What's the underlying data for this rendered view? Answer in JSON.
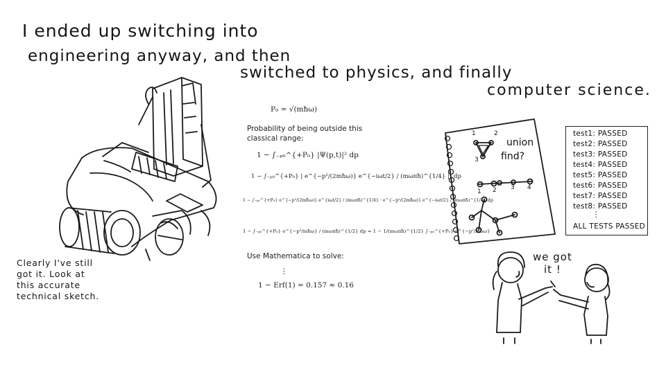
{
  "heading": {
    "line1": "I ended up switching into",
    "line2": "engineering anyway, and then",
    "line3": "switched to  physics, and finally",
    "line4": "computer science."
  },
  "caption": {
    "line1": "Clearly I've still",
    "line2": "got it. Look at",
    "line3": "this accurate",
    "line4": "technical sketch."
  },
  "math": {
    "p0": "P₀ = √(mħω)",
    "prob1": "Probability of being outside this",
    "prob2": "classical range:",
    "eq1": "1 − ∫₋ₚ₀^{+P₀} |Ψ(p,t)|² dp",
    "eq2": "1 − ∫₋ₚ₀^{+P₀} | e^{−p²/(2mħω)} e^{−iωt/2} / (mωπħ)^{1/4} |² dp",
    "eq3": "1 − ∫₋ₚ₀^{+P₀} e^{−p²/(2mħω)} e^{iωt/2} / (mωπħ)^{1/4} · e^{−p²/(2mħω)} e^{−iωt/2} / (mωπħ)^{1/4} dp",
    "eq4": "1 − ∫₋ₚ₀^{+P₀} e^{−p²/mħω} / (mωπħ)^{1/2} dp = 1 − 1/(mωπħ)^{1/2} ∫₋ₚ₀^{+P₀} e^{−p²/mħω}",
    "solve": "Use  Mathematica  to  solve:",
    "dots": "⋮",
    "result": "1 − Erf(1) = 0.157 ≈ 0.16"
  },
  "notebook": {
    "label_union": "union",
    "label_find": "find?",
    "nums_tri": [
      "1",
      "2",
      "3"
    ],
    "nums_line": [
      "1",
      "2",
      "3",
      "4"
    ]
  },
  "tests": {
    "rows": [
      "test1: PASSED",
      "test2: PASSED",
      "test3: PASSED",
      "test4: PASSED",
      "test5: PASSED",
      "test6: PASSED",
      "test7: PASSED",
      "test8: PASSED"
    ],
    "dots": "⋮",
    "summary": "ALL TESTS PASSED"
  },
  "speech": {
    "line1": "we got",
    "line2": "it !"
  }
}
